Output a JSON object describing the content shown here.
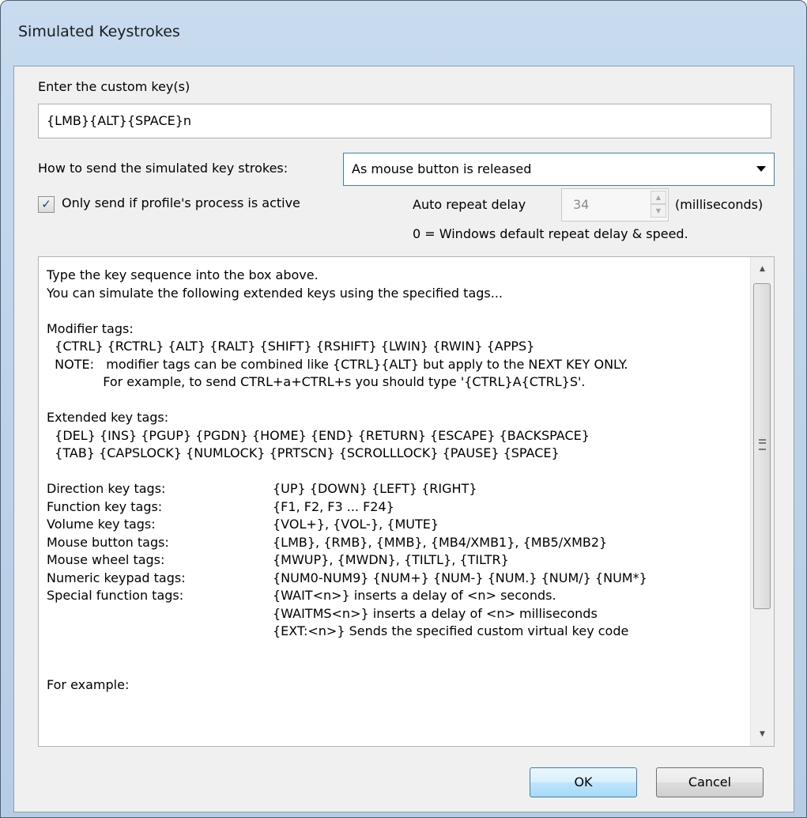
{
  "window": {
    "title": "Simulated Keystrokes"
  },
  "custom_keys": {
    "label": "Enter the custom key(s)",
    "value": "{LMB}{ALT}{SPACE}n"
  },
  "send_mode": {
    "label": "How to send the simulated key strokes:",
    "selected": "As mouse button is released"
  },
  "only_active": {
    "label": "Only send if profile's process is active",
    "checked": true,
    "check_glyph": "✓"
  },
  "auto_repeat": {
    "label": "Auto repeat delay",
    "value": "34",
    "units": "(milliseconds)",
    "note": "0 = Windows default repeat delay & speed."
  },
  "help": {
    "intro": [
      "Type the key sequence into the box above.",
      "You can simulate the following extended keys using the specified tags..."
    ],
    "modifier_heading": "Modifier tags:",
    "modifier_lines": [
      "  {CTRL} {RCTRL} {ALT} {RALT} {SHIFT} {RSHIFT} {LWIN} {RWIN} {APPS}",
      "  NOTE:   modifier tags can be combined like {CTRL}{ALT} but apply to the NEXT KEY ONLY.",
      "              For example, to send CTRL+a+CTRL+s you should type '{CTRL}A{CTRL}S'."
    ],
    "extended_heading": "Extended key tags:",
    "extended_lines": [
      "  {DEL} {INS} {PGUP} {PGDN} {HOME} {END} {RETURN} {ESCAPE} {BACKSPACE}",
      "  {TAB} {CAPSLOCK} {NUMLOCK} {PRTSCN} {SCROLLLOCK} {PAUSE} {SPACE}"
    ],
    "tag_rows": [
      {
        "name": "Direction key tags:",
        "value": "{UP} {DOWN} {LEFT} {RIGHT}"
      },
      {
        "name": "Function key tags:",
        "value": "{F1, F2, F3 ... F24}"
      },
      {
        "name": "Volume key tags:",
        "value": "{VOL+}, {VOL-}, {MUTE}"
      },
      {
        "name": "Mouse button tags:",
        "value": "{LMB}, {RMB}, {MMB}, {MB4/XMB1}, {MB5/XMB2}"
      },
      {
        "name": "Mouse wheel tags:",
        "value": "{MWUP}, {MWDN}, {TILTL}, {TILTR}"
      },
      {
        "name": "Numeric keypad tags:",
        "value": "{NUM0-NUM9} {NUM+} {NUM-} {NUM.} {NUM/} {NUM*}"
      },
      {
        "name": "Special function tags:",
        "value": "{WAIT<n>} inserts a delay of <n> seconds."
      },
      {
        "name": "",
        "value": "{WAITMS<n>} inserts a delay of <n> milliseconds"
      },
      {
        "name": "",
        "value": "{EXT:<n>} Sends the specified custom virtual key code"
      }
    ],
    "example_heading": "For example:"
  },
  "scrollbar": {
    "up_glyph": "▲",
    "down_glyph": "▼",
    "thumb_position": "top"
  },
  "buttons": {
    "ok": "OK",
    "cancel": "Cancel"
  },
  "colors": {
    "title_bar": "#c8dbef",
    "dialog_bg": "#f0f0f0",
    "default_button": "#bee6fd"
  }
}
